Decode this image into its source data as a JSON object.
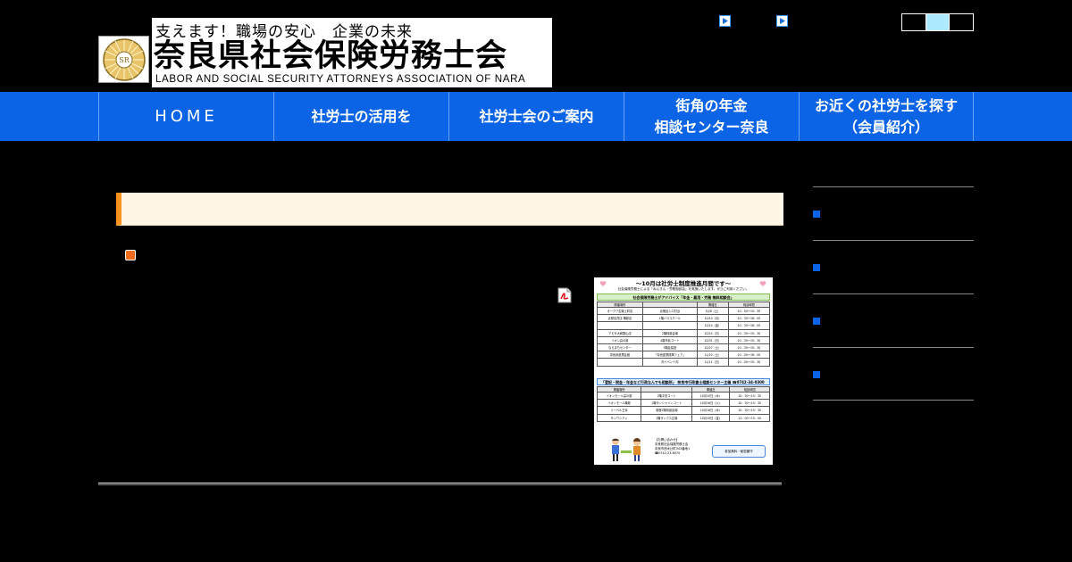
{
  "header": {
    "tagline": "支えます！職場の安心　企業の未来",
    "org_name": "奈良県社会保険労務士会",
    "org_name_en": "LABOR AND SOCIAL SECURITY ATTORNEYS ASSOCIATION OF NARA",
    "emblem_text": "SR"
  },
  "nav": {
    "items": [
      {
        "label": "HOME"
      },
      {
        "label": "社労士の活用を"
      },
      {
        "label": "社労士会のご案内"
      },
      {
        "label_line1": "街角の年金",
        "label_line2": "相談センター奈良"
      },
      {
        "label_line1": "お近くの社労士を探す",
        "label_line2": "（会員紹介）"
      }
    ]
  },
  "flyer": {
    "title": "～10月は社労士制度推進月間です～",
    "subtitle": "社会保険労務士による「ねんきん・労務相談会」を実施いたします。ぜひご利用ください。",
    "band1": "社会保険労務士がアドバイス「年金・雇用・労務 無料相談会」",
    "table1_headers": [
      "開催場所",
      "",
      "開催日",
      "相談時間"
    ],
    "table1_rows": [
      [
        "オークワ生駒上町店",
        "北側出入口付近",
        "10/8（土）",
        "10：00〜15：30"
      ],
      [
        "近鉄百貨店 橿原店",
        "1階バラスホール",
        "10/10（月）",
        "10：30〜16：00"
      ],
      [
        "",
        "",
        "10/14（金）",
        "10：30〜16：00"
      ],
      [
        "アピタ大和郡山店",
        "2階特設会場",
        "10/14（日）",
        "10：30〜15：30"
      ],
      [
        "イオン高の原",
        "4階市民コート",
        "10/31（日）",
        "10：30〜15：30"
      ],
      [
        "ならまちセンター",
        "3階会議室",
        "10/27（土）",
        "10：30〜15：30"
      ],
      [
        "奈良県産業会館",
        "「奈良産業振興フェア」",
        "11/10（土）",
        "10：00〜16：00"
      ],
      [
        "",
        "内イベント内",
        "11/11（日）",
        "10：00〜15：30"
      ]
    ],
    "band2": "「登記・税金・年金など行政なんでも相談所」 奈良市行政書士相談センター主催 ☎0742-34-0300",
    "table2_headers": [
      "開催場所",
      "",
      "開催日",
      "相談時間"
    ],
    "table2_rows": [
      [
        "イオンモール高の原",
        "2階平安コート",
        "10月10日（木）",
        "10：30〜15：30"
      ],
      [
        "イオンモール橿原",
        "1階サンシャインコート",
        "10月16日（火）",
        "10：30〜15：30"
      ],
      [
        "リーベル王寺",
        "東館2階特設会場",
        "10月18日（木）",
        "10：30〜15：30"
      ],
      [
        "サンワシティ",
        "1階サンクス広場",
        "10月19日（金）",
        "11：00〜15：00"
      ]
    ],
    "contact_line1": "【お問い合わせ】",
    "contact_line2": "奈良県社会保険労務士会",
    "contact_line3": "奈良市西木辻町343番地1",
    "contact_line4": "☎0742-23-6070",
    "button_label": "参加無料・秘密厳守"
  },
  "sidebar": {
    "items": [
      {
        "label": ""
      },
      {
        "label": ""
      },
      {
        "label": ""
      },
      {
        "label": ""
      }
    ]
  },
  "colors": {
    "nav_blue": "#0b64e6",
    "heading_accent": "#f7931e",
    "heading_bg": "#fdf6e6",
    "bullet_orange": "#f26b1d",
    "fontsize_active": "#aee9ff"
  },
  "icons": {
    "utility_link_1": "play-arrow-icon",
    "utility_link_2": "play-arrow-icon",
    "pdf": "pdf-icon",
    "emblem": "sr-emblem-icon"
  }
}
